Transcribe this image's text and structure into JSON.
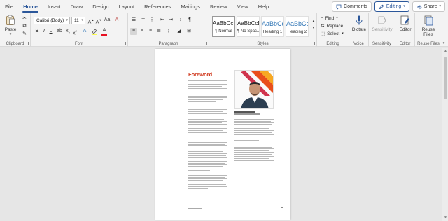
{
  "menu": {
    "items": [
      "File",
      "Home",
      "Insert",
      "Draw",
      "Design",
      "Layout",
      "References",
      "Mailings",
      "Review",
      "View",
      "Help"
    ],
    "active": "Home",
    "comments_label": "Comments",
    "editing_label": "Editing",
    "share_label": "Share"
  },
  "ribbon": {
    "clipboard": {
      "paste_label": "Paste",
      "group_label": "Clipboard"
    },
    "font": {
      "font_name": "Calibri (Body)",
      "font_size": "11",
      "group_label": "Font"
    },
    "paragraph": {
      "group_label": "Paragraph"
    },
    "styles": {
      "tiles": [
        {
          "sample": "AaBbCcDc",
          "name": "¶ Normal"
        },
        {
          "sample": "AaBbCcDc",
          "name": "¶ No Spac..."
        },
        {
          "sample": "AaBbCc",
          "name": "Heading 1"
        },
        {
          "sample": "AaBbCcC",
          "name": "Heading 2"
        }
      ],
      "group_label": "Styles"
    },
    "editing": {
      "find_label": "Find",
      "replace_label": "Replace",
      "select_label": "Select",
      "group_label": "Editing"
    },
    "voice": {
      "dictate_label": "Dictate",
      "group_label": "Voice"
    },
    "sensitivity": {
      "button_label": "Sensitivity",
      "group_label": "Sensitivity"
    },
    "editor": {
      "button_label": "Editor",
      "group_label": "Editor"
    },
    "reuse": {
      "button_label": "Reuse Files",
      "group_label": "Reuse Files"
    }
  },
  "document": {
    "title": "Foreword",
    "accent_color": "#d03a1f"
  },
  "colors": {
    "brand": "#2b579a"
  }
}
